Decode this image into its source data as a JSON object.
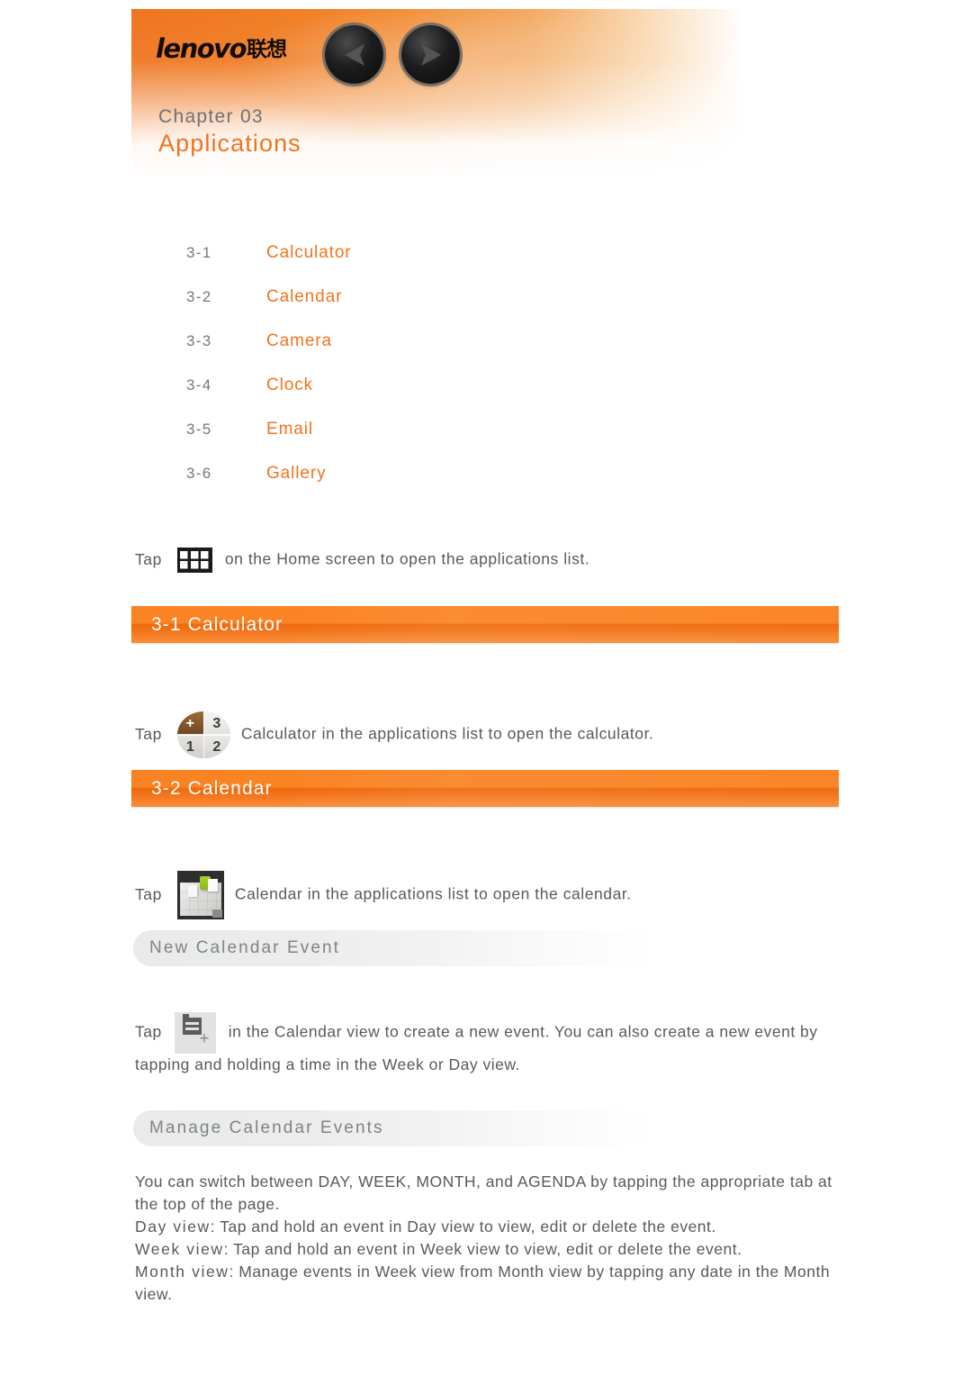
{
  "header": {
    "logo_text": "lenovo",
    "logo_cjk": "联想",
    "prev_label": "previous-page",
    "next_label": "next-page",
    "chapter_label": "Chapter 03",
    "chapter_title": "Applications",
    "accent_color": "#f4721c"
  },
  "toc": {
    "items": [
      {
        "num": "3-1",
        "label": "Calculator"
      },
      {
        "num": "3-2",
        "label": "Calendar"
      },
      {
        "num": "3-3",
        "label": "Camera"
      },
      {
        "num": "3-4",
        "label": "Clock"
      },
      {
        "num": "3-5",
        "label": "Email"
      },
      {
        "num": "3-6",
        "label": "Gallery"
      }
    ]
  },
  "intro": {
    "lead": "Tap",
    "icon": "apps-grid-icon",
    "rest": "on the Home screen to open the applications list."
  },
  "sections": [
    {
      "bar": "3-1 Calculator",
      "lead": "Tap",
      "icon": "calculator-app-icon",
      "rest": "Calculator in the applications list to open the calculator."
    },
    {
      "bar": "3-2 Calendar",
      "lead": "Tap",
      "icon": "calendar-app-icon",
      "rest": "Calendar in the applications list to open the calendar."
    }
  ],
  "subsections": [
    {
      "title": "New Calendar Event",
      "lead": "Tap",
      "icon": "new-event-icon",
      "body": "in the Calendar view to create a new event. You can also create a new event by tapping and holding a time in the Week or Day view."
    },
    {
      "title": "Manage Calendar Events",
      "body_lines": [
        "You can switch between DAY, WEEK, MONTH, and AGENDA by tapping the appropriate tab at the top of the page.",
        "Day view",
        ": Tap and hold an event in Day view to view, edit or delete the event.",
        "Week view",
        ": Tap and hold an event in Week view to view, edit or delete the event.",
        "Month view",
        ": Manage events in Week view from Month view by tapping any date in the Month view."
      ]
    }
  ],
  "calculator_icon": {
    "q1": "+",
    "q2": "3",
    "q3": "1",
    "q4": "2"
  }
}
